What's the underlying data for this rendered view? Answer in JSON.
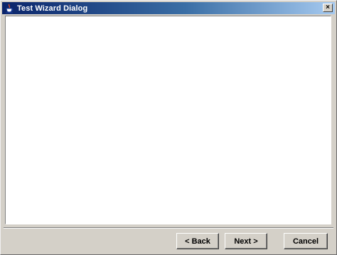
{
  "window": {
    "title": "Test Wizard Dialog",
    "icon": "java-cup-icon",
    "close_label": "×"
  },
  "buttons": {
    "back_label": "< Back",
    "next_label": "Next >",
    "cancel_label": "Cancel"
  },
  "colors": {
    "title_start": "#0a246a",
    "title_end": "#a6caf0",
    "face": "#d4d0c8",
    "content_bg": "#ffffff"
  }
}
